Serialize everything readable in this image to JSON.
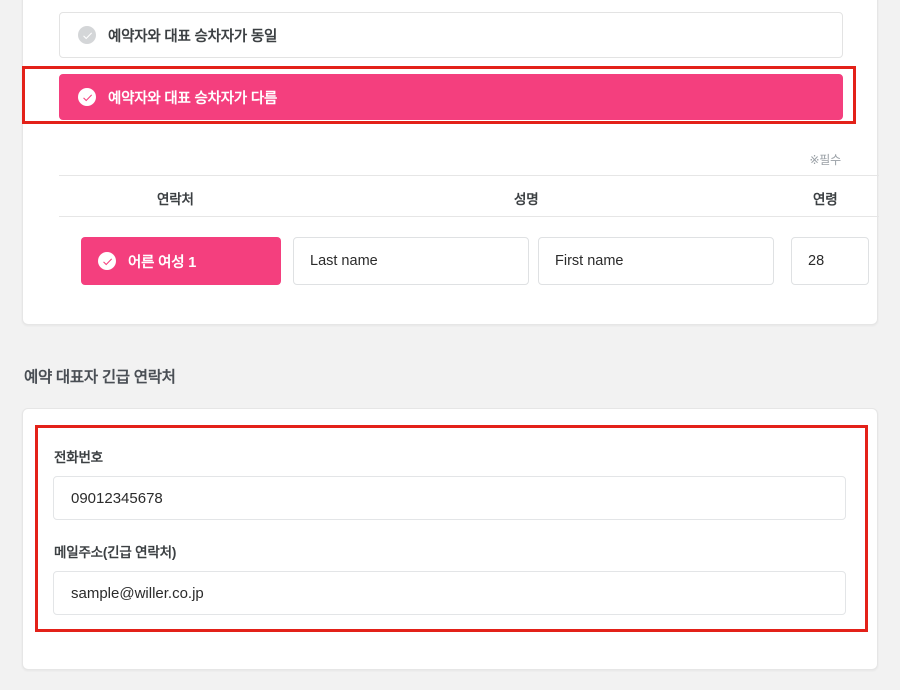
{
  "passenger_section": {
    "options": [
      {
        "label": "예약자와 대표 승차자가 동일",
        "selected": false,
        "icon": "check-circle-icon"
      },
      {
        "label": "예약자와 대표 승차자가 다름",
        "selected": true,
        "icon": "check-circle-icon"
      }
    ],
    "required_note": "※필수",
    "table": {
      "headers": [
        "연락처",
        "성명",
        "연령"
      ],
      "rows": [
        {
          "badge": "어른 여성 1",
          "badge_icon": "check-circle-icon",
          "last_name": "Last name",
          "first_name": "First name",
          "age": "28"
        }
      ]
    }
  },
  "contact_section": {
    "title": "예약 대표자 긴급 연락처",
    "fields": [
      {
        "label": "전화번호",
        "value": "09012345678"
      },
      {
        "label": "메일주소(긴급 연락처)",
        "value": "sample@willer.co.jp"
      }
    ]
  },
  "colors": {
    "accent_pink": "#f43f7e",
    "annotation_red": "#e32119",
    "page_background": "#f2f2f2",
    "card_background": "#ffffff",
    "text_primary": "#3c4043",
    "text_muted": "#9aa0a6"
  }
}
